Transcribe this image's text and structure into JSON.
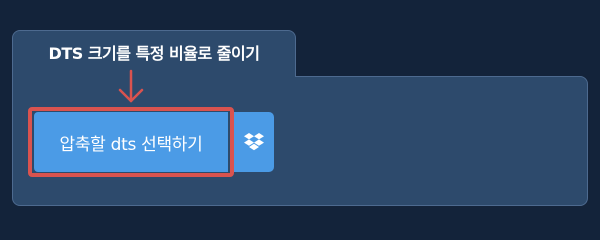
{
  "panel": {
    "title": "DTS 크기를 특정 비율로 줄이기"
  },
  "upload": {
    "label": "압축할 dts 선택하기"
  },
  "icons": {
    "arrow": "down-arrow-icon",
    "dropbox": "dropbox-icon"
  },
  "colors": {
    "page_background": "#13233a",
    "panel_background": "#2d4a6c",
    "panel_border": "#4d6a8f",
    "button_blue": "#4b9be6",
    "highlight_red": "#d9534f"
  }
}
